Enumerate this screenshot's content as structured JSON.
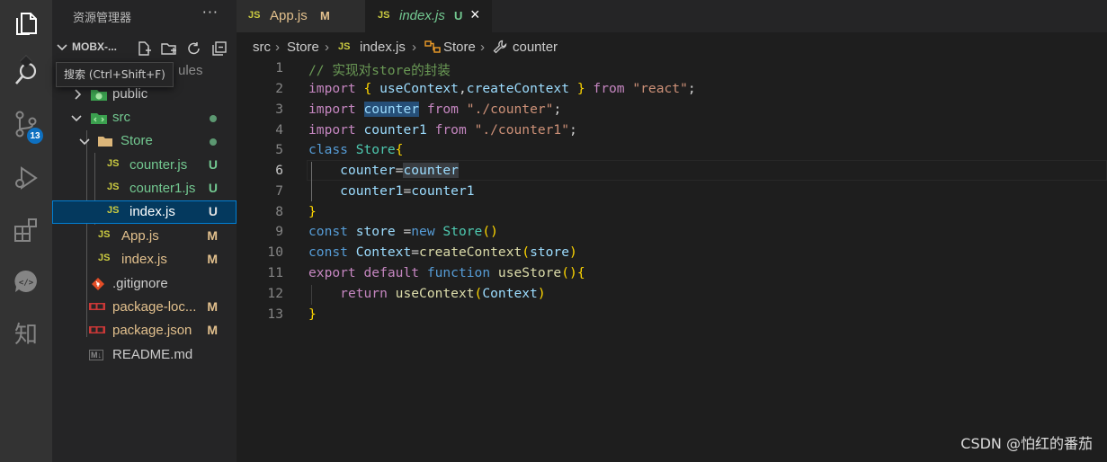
{
  "activity_bar": {
    "items": [
      {
        "icon": "files-icon"
      },
      {
        "icon": "search-icon"
      },
      {
        "icon": "source-control-icon",
        "badge": "13"
      },
      {
        "icon": "run-debug-icon"
      },
      {
        "icon": "extensions-icon"
      },
      {
        "icon": "live-share-icon"
      },
      {
        "text": "知"
      }
    ]
  },
  "tooltip": "搜索 (Ctrl+Shift+F)",
  "sidebar": {
    "title": "资源管理器",
    "more": "···",
    "project": "MOBX-...",
    "hidden_label": "ules",
    "tree": [
      {
        "label": "public",
        "kind": "folder-public"
      },
      {
        "label": "src",
        "kind": "folder-src"
      },
      {
        "label": "Store",
        "kind": "folder"
      },
      {
        "label": "counter.js",
        "kind": "js",
        "status": "U"
      },
      {
        "label": "counter1.js",
        "kind": "js",
        "status": "U"
      },
      {
        "label": "index.js",
        "kind": "js",
        "status": "U"
      },
      {
        "label": "App.js",
        "kind": "js",
        "status": "M"
      },
      {
        "label": "index.js",
        "kind": "js",
        "status": "M"
      },
      {
        "label": ".gitignore",
        "kind": "git"
      },
      {
        "label": "package-loc...",
        "kind": "npm",
        "status": "M"
      },
      {
        "label": "package.json",
        "kind": "npm",
        "status": "M"
      },
      {
        "label": "README.md",
        "kind": "md"
      }
    ],
    "js_icon": "JS",
    "md_icon": "M↓"
  },
  "tabs": [
    {
      "label": "App.js",
      "status": "M"
    },
    {
      "label": "index.js",
      "status": "U",
      "close": "×"
    }
  ],
  "breadcrumb": {
    "src": "src",
    "store": "Store",
    "file": "index.js",
    "class": "Store",
    "prop": "counter"
  },
  "editor": {
    "line_numbers": [
      "1",
      "2",
      "3",
      "4",
      "5",
      "6",
      "7",
      "8",
      "9",
      "10",
      "11",
      "12",
      "13"
    ],
    "current_line": "6",
    "lines": [
      "// 实现对store的封装",
      "import { useContext,createContext } from \"react\";",
      "import counter from \"./counter\";",
      "import counter1 from \"./counter1\";",
      "class Store{",
      "    counter=counter",
      "    counter1=counter1",
      "}",
      "const store =new Store()",
      "const Context=createContext(store)",
      "export default function useStore(){",
      "    return useContext(Context)",
      "}"
    ]
  },
  "watermark": "CSDN @怕红的番茄",
  "colors": {
    "activity_bg": "#333333",
    "sidebar_bg": "#252526",
    "editor_bg": "#1e1e1e",
    "untracked": "#73c991",
    "modified": "#e2c08d",
    "badge": "#0e70c0"
  }
}
